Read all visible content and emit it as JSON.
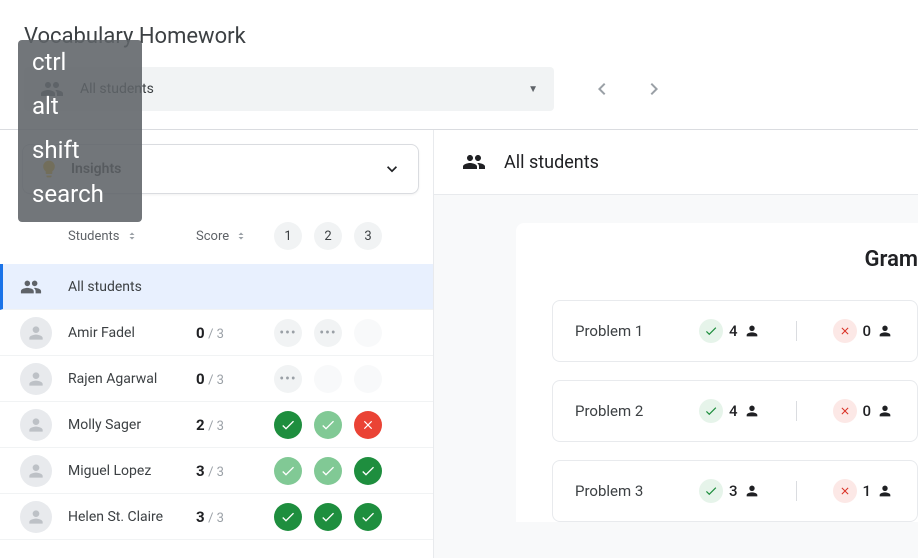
{
  "page_title": "Vocabulary Homework",
  "top_selector": {
    "label": "All students"
  },
  "insights": {
    "label": "Insights"
  },
  "table": {
    "header_students": "Students",
    "header_score": "Score",
    "problem_nums": [
      "1",
      "2",
      "3"
    ],
    "rows": [
      {
        "name": "All students",
        "active": true,
        "type": "all"
      },
      {
        "name": "Amir Fadel",
        "score": "0",
        "total": "3",
        "statuses": [
          "pending",
          "pending",
          "empty"
        ]
      },
      {
        "name": "Rajen Agarwal",
        "score": "0",
        "total": "3",
        "statuses": [
          "pending",
          "empty",
          "empty"
        ]
      },
      {
        "name": "Molly Sager",
        "score": "2",
        "total": "3",
        "statuses": [
          "correct",
          "correct-light",
          "wrong"
        ]
      },
      {
        "name": "Miguel Lopez",
        "score": "3",
        "total": "3",
        "statuses": [
          "correct-light",
          "correct-light",
          "correct"
        ]
      },
      {
        "name": "Helen St. Claire",
        "score": "3",
        "total": "3",
        "statuses": [
          "correct",
          "correct",
          "correct"
        ]
      }
    ]
  },
  "right": {
    "header_title": "All students",
    "card_title": "Gram",
    "problems": [
      {
        "label": "Problem 1",
        "correct": "4",
        "wrong": "0"
      },
      {
        "label": "Problem 2",
        "correct": "4",
        "wrong": "0"
      },
      {
        "label": "Problem 3",
        "correct": "3",
        "wrong": "1"
      }
    ]
  },
  "keyboard": {
    "k1": "ctrl",
    "k2": "alt",
    "k3": "shift",
    "k4": "search"
  }
}
